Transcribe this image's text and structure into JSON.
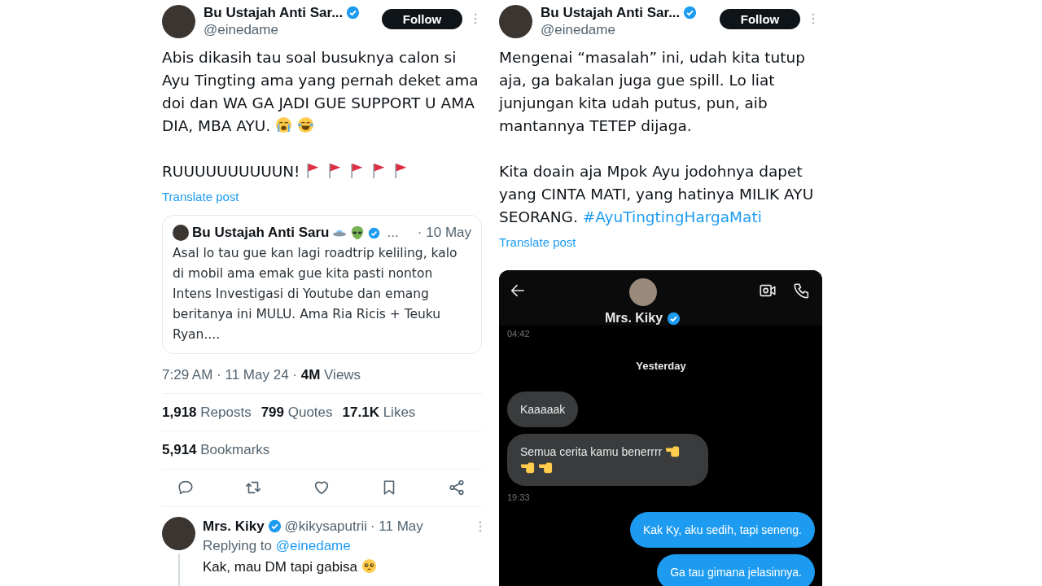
{
  "left_post": {
    "author": {
      "name": "Bu Ustajah Anti Sar...",
      "handle": "@einedame",
      "verified": true
    },
    "follow_button": "Follow",
    "paragraphs": [
      {
        "text": "Abis dikasih tau soal busuknya calon si Ayu Tingting ama yang pernah deket ama doi dan WA GA JADI GUE SUPPORT U AMA DIA, MBA AYU.",
        "emojis": [
          {
            "kind": "crying"
          },
          {
            "kind": "laughing"
          }
        ]
      },
      {
        "text": "RUUUUUUUUUUN!",
        "emojis": [
          {
            "kind": "red-flag"
          },
          {
            "kind": "red-flag"
          },
          {
            "kind": "red-flag"
          },
          {
            "kind": "red-flag"
          },
          {
            "kind": "red-flag"
          }
        ]
      }
    ],
    "translate": "Translate post",
    "quote": {
      "name": "Bu Ustajah Anti Saru",
      "emojis": [
        {
          "kind": "ufo"
        },
        {
          "kind": "alien"
        }
      ],
      "verified": true,
      "ellipsis": "...",
      "date": "· 10 May",
      "text": "Asal lo tau gue kan lagi roadtrip keliling, kalo di mobil ama emak gue kita pasti nonton Intens Investigasi di Youtube dan emang beritanya ini MULU. Ama Ria Ricis + Teuku Ryan...."
    },
    "meta": "7:29 AM · 11 May 24 · **4M** Views",
    "stats": [
      "**1,918** Reposts",
      "**799** Quotes",
      "**17.1K** Likes"
    ],
    "bookmarks": "**5,914** Bookmarks",
    "actions": [
      {
        "kind": "reply"
      },
      {
        "kind": "repost"
      },
      {
        "kind": "like"
      },
      {
        "kind": "bookmark"
      },
      {
        "kind": "share"
      }
    ],
    "reply": {
      "name": "Mrs. Kiky",
      "verified": true,
      "handle": "@kikysaputrii",
      "date": "· 11 May",
      "replying_label": "Replying to",
      "replying_handle": "@einedame",
      "text": "Kak, mau DM tapi gabisa",
      "emojis": [
        {
          "kind": "pleading"
        }
      ]
    }
  },
  "right_post": {
    "author": {
      "name": "Bu Ustajah Anti Sar...",
      "handle": "@einedame",
      "verified": true
    },
    "follow_button": "Follow",
    "paragraphs": [
      {
        "text": "Mengenai “masalah” ini, udah kita tutup aja, ga bakalan juga gue spill. Lo liat junjungan kita udah putus, pun, aib mantannya TETEP dijaga."
      },
      {
        "text": "Kita doain aja Mpok Ayu jodohnya dapet yang CINTA MATI, yang hatinya MILIK AYU SEORANG.",
        "hashtag": "#AyuTingtingHargaMati"
      }
    ],
    "translate": "Translate post",
    "dm": {
      "name": "Mrs. Kiky",
      "verified": true,
      "messages": [
        {
          "kind": "time",
          "text": "04:42"
        },
        {
          "kind": "day",
          "text": "Yesterday"
        },
        {
          "kind": "received",
          "text": "Kaaaaak"
        },
        {
          "kind": "received",
          "text": "Semua cerita kamu benerrrr",
          "emojis": [
            {
              "kind": "pointing"
            },
            {
              "kind": "pointing"
            },
            {
              "kind": "pointing"
            }
          ]
        },
        {
          "kind": "time",
          "text": "19:33"
        },
        {
          "kind": "sent",
          "text": "Kak Ky, aku sedih, tapi seneng."
        },
        {
          "kind": "sent",
          "text": "Ga tau gimana jelasinnya."
        }
      ]
    }
  }
}
